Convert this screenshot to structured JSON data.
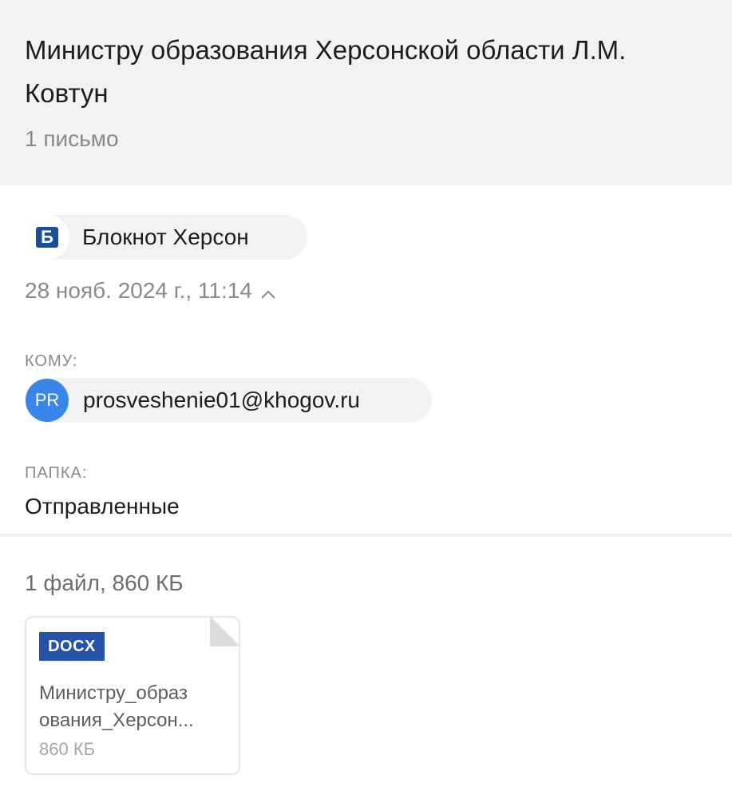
{
  "message": {
    "subject_line1": "Министру образования Херсонской области Л.М.",
    "subject_line2": "Ковтун",
    "count": "1 письмо"
  },
  "sender": {
    "logo_letter": "Б",
    "name": "Блокнот Херсон"
  },
  "date": "28 нояб. 2024 г., 11:14",
  "to": {
    "label": "КОМУ:",
    "avatar_initials": "PR",
    "email": "prosveshenie01@khogov.ru"
  },
  "folder": {
    "label": "ПАПКА:",
    "value": "Отправленные"
  },
  "attachments": {
    "summary": "1 файл, 860 КБ",
    "files": [
      {
        "type": "DOCX",
        "name_line1": "Министру_образ",
        "name_line2": "ования_Херсон...",
        "size": "860 КБ"
      }
    ]
  },
  "colors": {
    "header_bg": "#f3f2f1",
    "avatar": "#3a85e8",
    "docx_badge": "#2554a6",
    "sender_logo": "#1f4e99"
  },
  "icons": {
    "sender_logo": "blocknot-logo-icon",
    "date_toggle": "chevron-up-icon"
  }
}
